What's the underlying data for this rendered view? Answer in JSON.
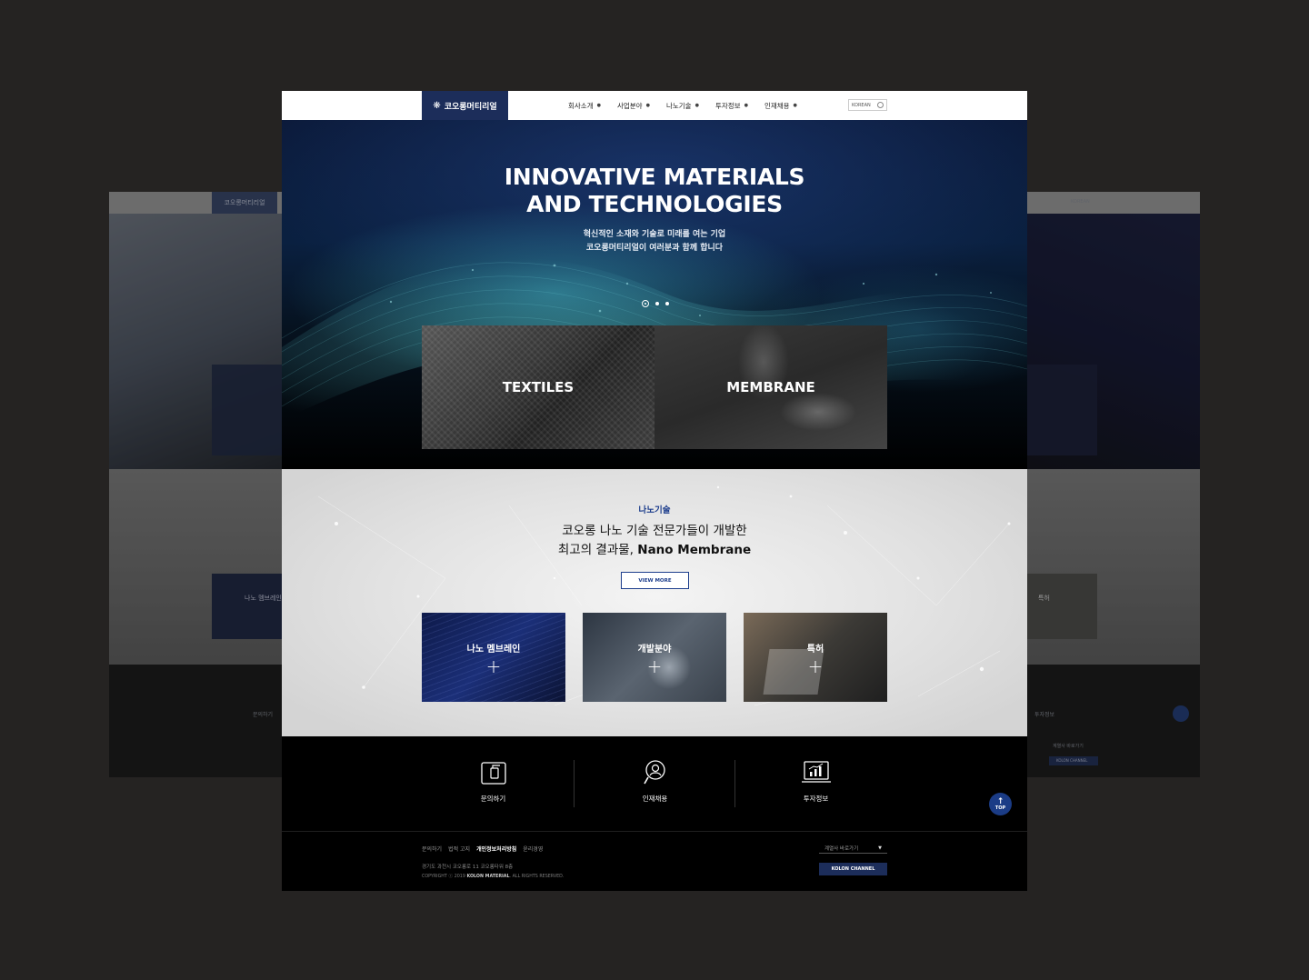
{
  "header": {
    "logo_text": "코오롱머티리얼",
    "menu": [
      {
        "label": "회사소개"
      },
      {
        "label": "사업분야"
      },
      {
        "label": "나노기술"
      },
      {
        "label": "투자정보"
      },
      {
        "label": "인재채용"
      }
    ],
    "language": "KOREAN"
  },
  "hero": {
    "title_line1": "INNOVATIVE MATERIALS",
    "title_line2": "AND TECHNOLOGIES",
    "subtitle_line1": "혁신적인 소재와 기술로 미래를 여는 기업",
    "subtitle_line2": "코오롱머티리얼이 여러분과 함께 합니다",
    "slide_count": 3,
    "active_slide": 1,
    "tiles": [
      {
        "label": "TEXTILES"
      },
      {
        "label": "MEMBRANE"
      }
    ]
  },
  "nano": {
    "label": "나노기술",
    "title_line1": "코오롱 나노 기술 전문가들이 개발한",
    "title_line2_prefix": "최고의 결과물, ",
    "title_line2_strong": "Nano Membrane",
    "view_more": "VIEW MORE",
    "cards": [
      {
        "label": "나노 멤브레인",
        "plus": "+"
      },
      {
        "label": "개발분야",
        "plus": "+"
      },
      {
        "label": "특허",
        "plus": "+"
      }
    ]
  },
  "quicklinks": [
    {
      "label": "문의하기",
      "icon": "inquiry-icon"
    },
    {
      "label": "인재채용",
      "icon": "recruit-icon"
    },
    {
      "label": "투자정보",
      "icon": "investment-icon"
    }
  ],
  "top_button": {
    "arrow": "↑",
    "label": "TOP"
  },
  "footer": {
    "links": [
      "문의하기",
      "법적 고지",
      "개인정보처리방침",
      "윤리경영"
    ],
    "address": "경기도 과천시 코오롱로 11 코오롱타워 8층",
    "copyright_prefix": "COPYRIGHT ⓒ 2019 ",
    "copyright_brand": "KOLON MATERIAL",
    "copyright_suffix": ". ALL RIGHTS RESERVED.",
    "family_select": "계열사 바로가기",
    "channel_button": "KOLON CHANNEL"
  },
  "background_pages": {
    "left_logo": "코오롱머티리얼",
    "left_card_label": "나노 멤브레인",
    "left_quick_label": "문의하기",
    "right_card_label": "특허",
    "right_quick_label": "투자정보",
    "right_select": "계열사 바로가기",
    "right_channel": "KOLON CHANNEL",
    "right_lang": "KOREAN"
  },
  "colors": {
    "brand_navy": "#1c2d5a",
    "accent_blue": "#1c3d8c",
    "backdrop": "#252322"
  }
}
